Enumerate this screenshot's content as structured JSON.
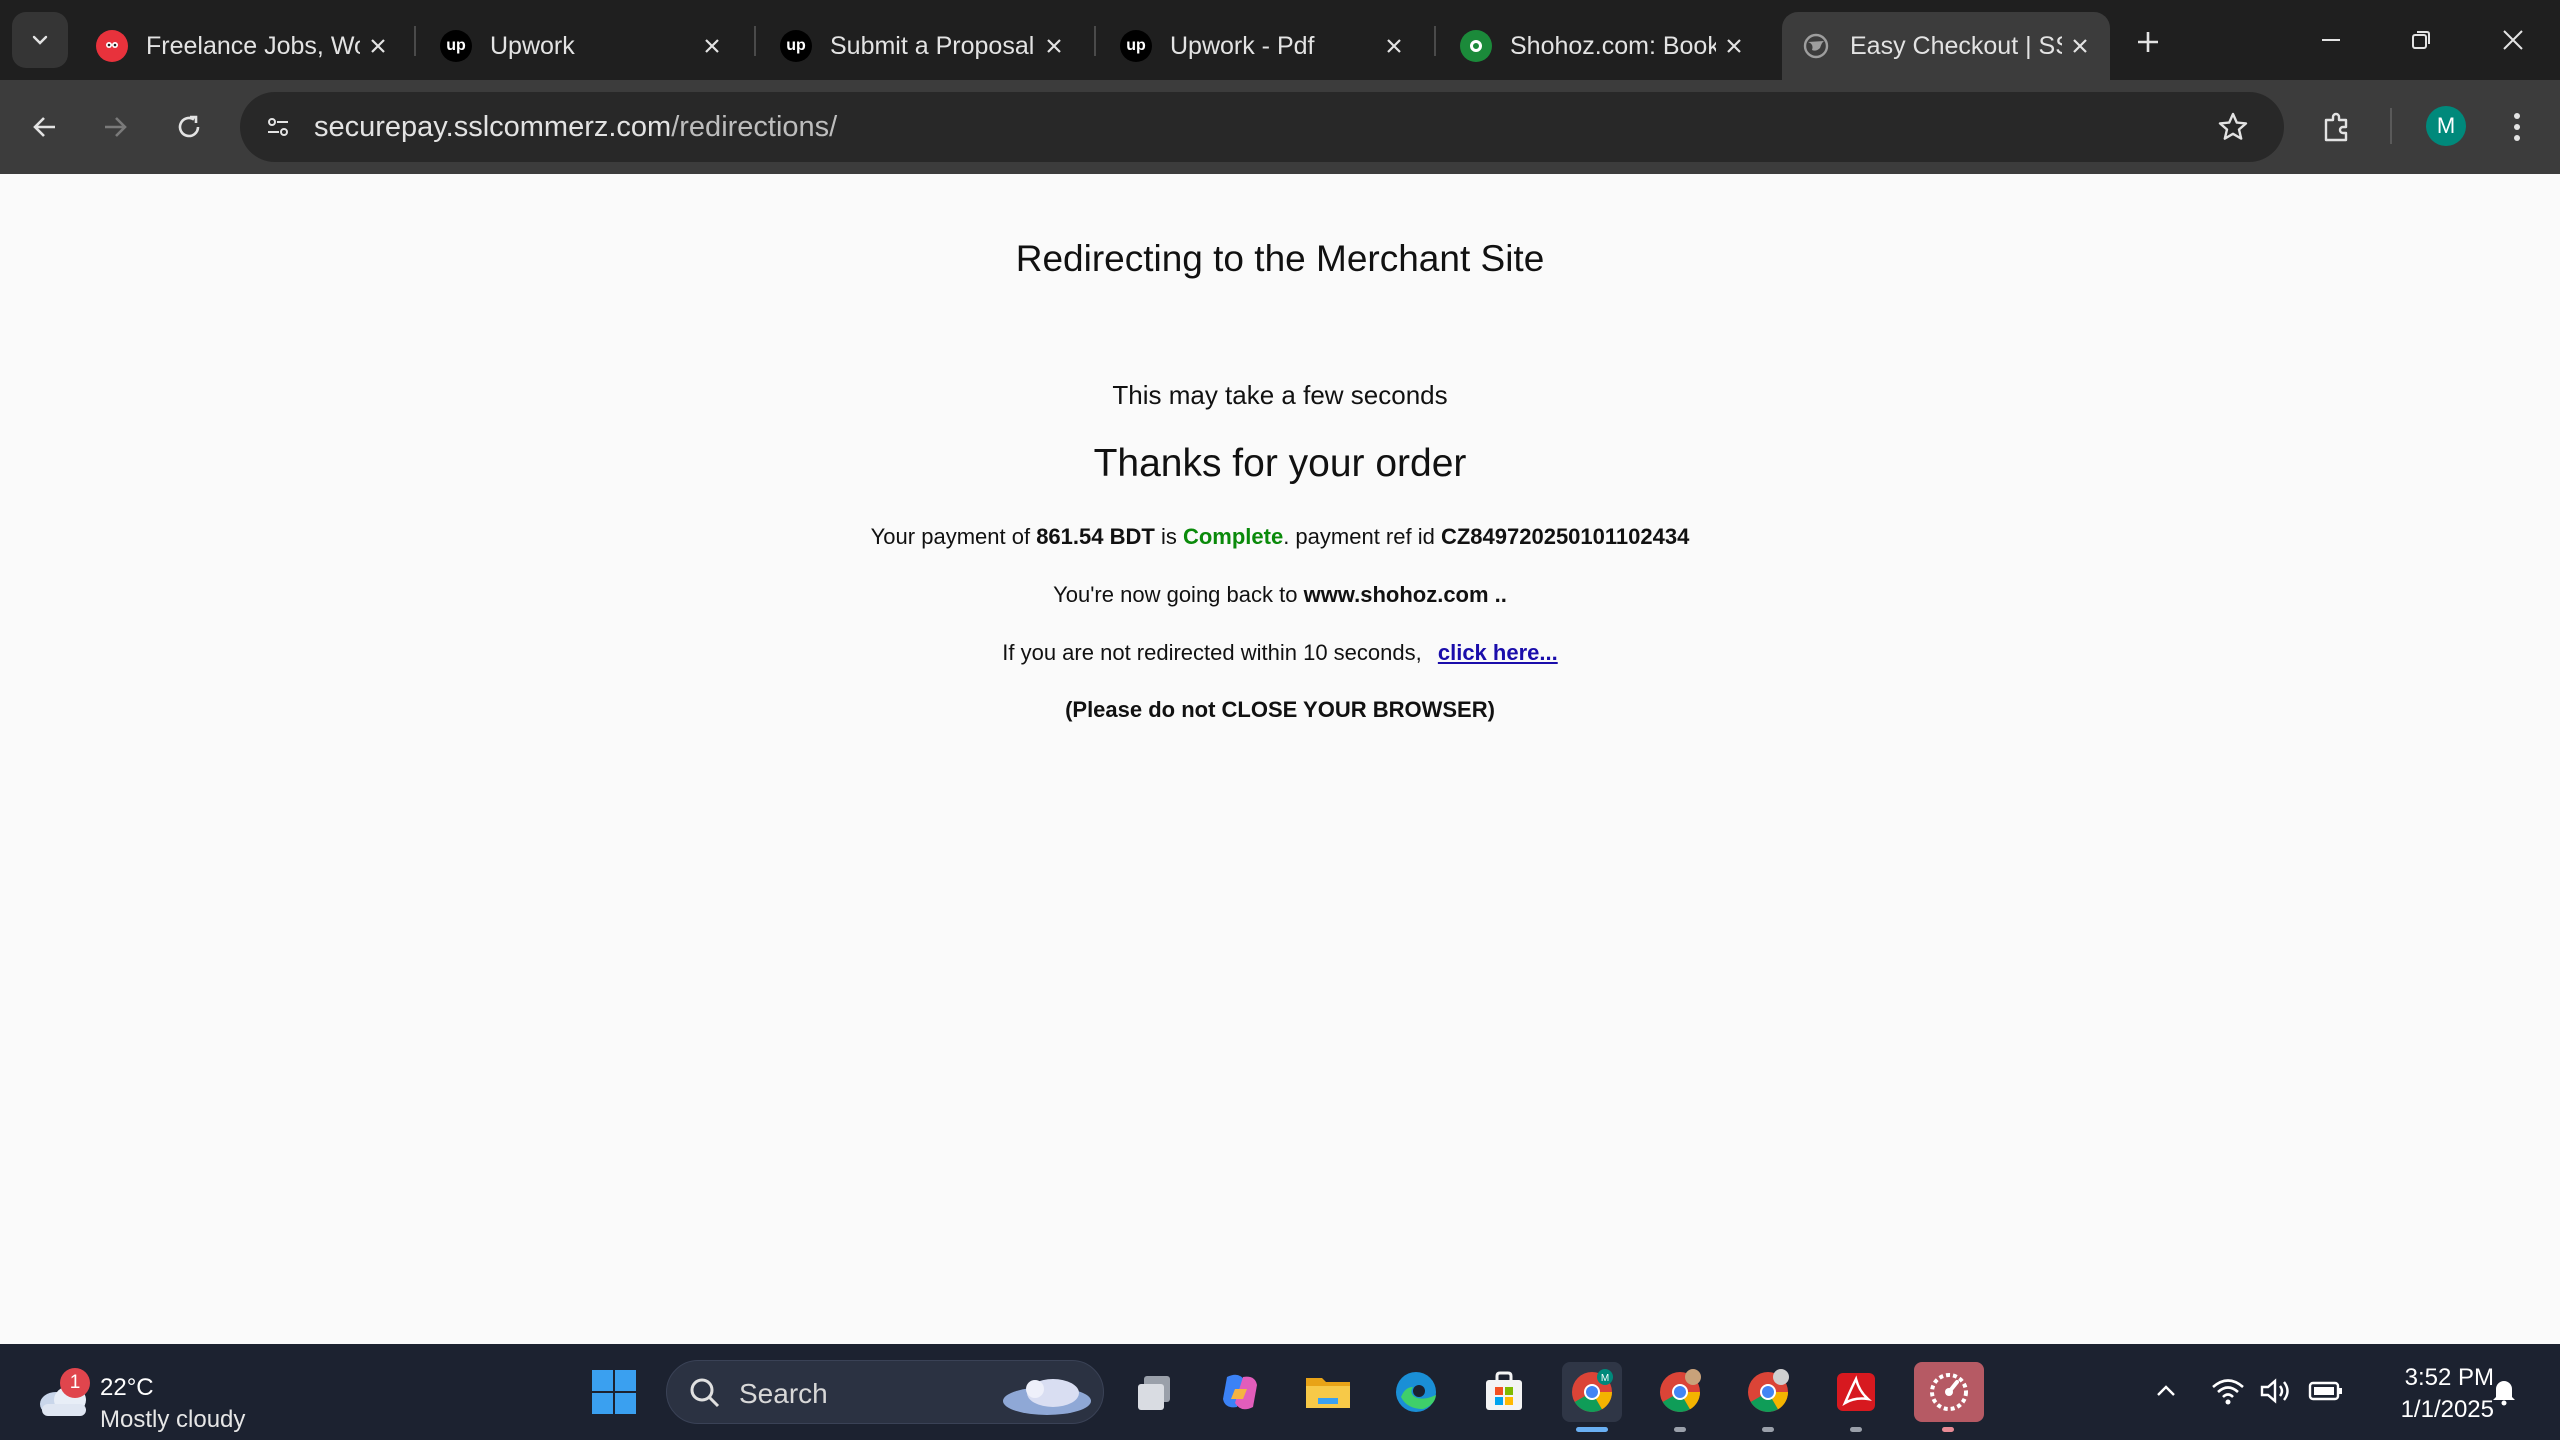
{
  "browser": {
    "tabs": [
      {
        "title": "Freelance Jobs, Wo",
        "icon": "freelancer-icon",
        "active": false
      },
      {
        "title": "Upwork",
        "icon": "upwork-icon",
        "active": false
      },
      {
        "title": "Submit a Proposal",
        "icon": "upwork-icon",
        "active": false
      },
      {
        "title": "Upwork - Pdf",
        "icon": "upwork-icon",
        "active": false
      },
      {
        "title": "Shohoz.com: Book",
        "icon": "shohoz-icon",
        "active": false
      },
      {
        "title": "Easy Checkout | SS",
        "icon": "globe-icon",
        "active": true
      }
    ],
    "url_domain": "securepay.sslcommerz.com",
    "url_path": "/redirections/",
    "profile_initial": "M"
  },
  "page": {
    "heading": "Redirecting to the Merchant Site",
    "subtext": "This may take a few seconds",
    "thanks": "Thanks for your order",
    "payment_prefix": "Your payment of",
    "amount": "861.54 BDT",
    "is_word": "is",
    "status": "Complete",
    "ref_label": ". payment ref id",
    "ref_id": "CZ849720250101102434",
    "going_back_prefix": "You're now going back to",
    "merchant": "www.shohoz.com ..",
    "redirect_notice": "If you are not redirected within 10 seconds,",
    "click_here": "click here...",
    "warning": "(Please do not CLOSE YOUR BROWSER)"
  },
  "taskbar": {
    "weather_temp": "22°C",
    "weather_cond": "Mostly cloudy",
    "weather_badge": "1",
    "search_label": "Search",
    "time": "3:52 PM",
    "date": "1/1/2025"
  },
  "colors": {
    "status_green": "#0a8a0a",
    "link_blue": "#1a0dab",
    "chrome_dark": "#1f1f1f",
    "toolbar": "#3c3c3c"
  }
}
